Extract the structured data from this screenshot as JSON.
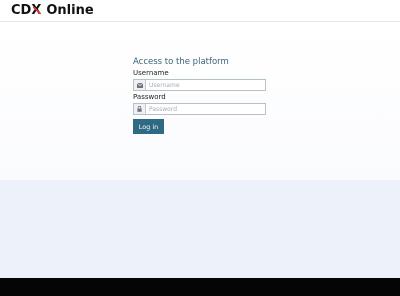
{
  "header": {
    "logo_cdx": "CDX",
    "logo_online": "Online"
  },
  "login": {
    "title": "Access to the platform",
    "username_label": "Username",
    "username_placeholder": "Username",
    "username_value": "",
    "username_icon": "envelope-icon",
    "password_label": "Password",
    "password_placeholder": "Password",
    "password_value": "",
    "password_icon": "lock-icon",
    "submit_label": "Log in"
  },
  "colors": {
    "brand_accent": "#e03a2f",
    "button": "#2f6a85",
    "title": "#3a6177",
    "lower_band": "#edf1f9",
    "footer": "#050505"
  }
}
